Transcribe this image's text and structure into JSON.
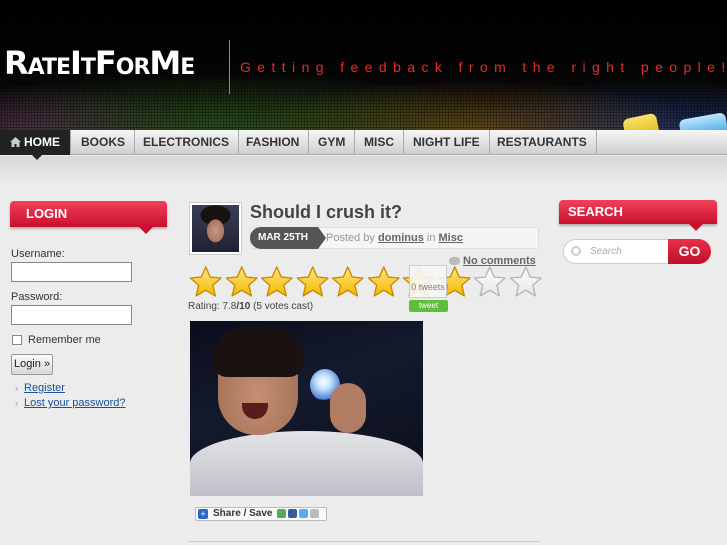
{
  "site": {
    "logo": "RateItForMe",
    "tagline": "Getting feedback from the right people!"
  },
  "nav": {
    "items": [
      "HOME",
      "BOOKS",
      "ELECTRONICS",
      "FASHION",
      "GYM",
      "MISC",
      "NIGHT LIFE",
      "RESTAURANTS"
    ],
    "active": "HOME"
  },
  "login": {
    "title": "LOGIN",
    "username_label": "Username:",
    "username_value": "",
    "password_label": "Password:",
    "password_value": "",
    "remember_label": "Remember me",
    "submit_label": "Login »",
    "register_link": "Register",
    "lost_password_link": "Lost your password?"
  },
  "post": {
    "title": "Should I crush it?",
    "date": "MAR 25TH",
    "posted_by_prefix": "Posted by",
    "author": "dominus",
    "in_word": "in",
    "category": "Misc",
    "comments": "No comments",
    "rating": {
      "stars_total": 10,
      "stars_filled": 8,
      "label": "Rating:",
      "score": "7.8",
      "out_of": "/10",
      "votes": "(5 votes cast)"
    },
    "tweet_count": "0",
    "tweet_count_unit": "tweets",
    "tweet_button": "tweet",
    "share_label": "Share / Save"
  },
  "search": {
    "title": "SEARCH",
    "placeholder": "Search",
    "go_label": "GO"
  },
  "colors": {
    "accent_red": "#d4163a",
    "star_gold": "#f5b800",
    "link_blue": "#1b4fa0",
    "tweet_green": "#5fbf3a"
  }
}
